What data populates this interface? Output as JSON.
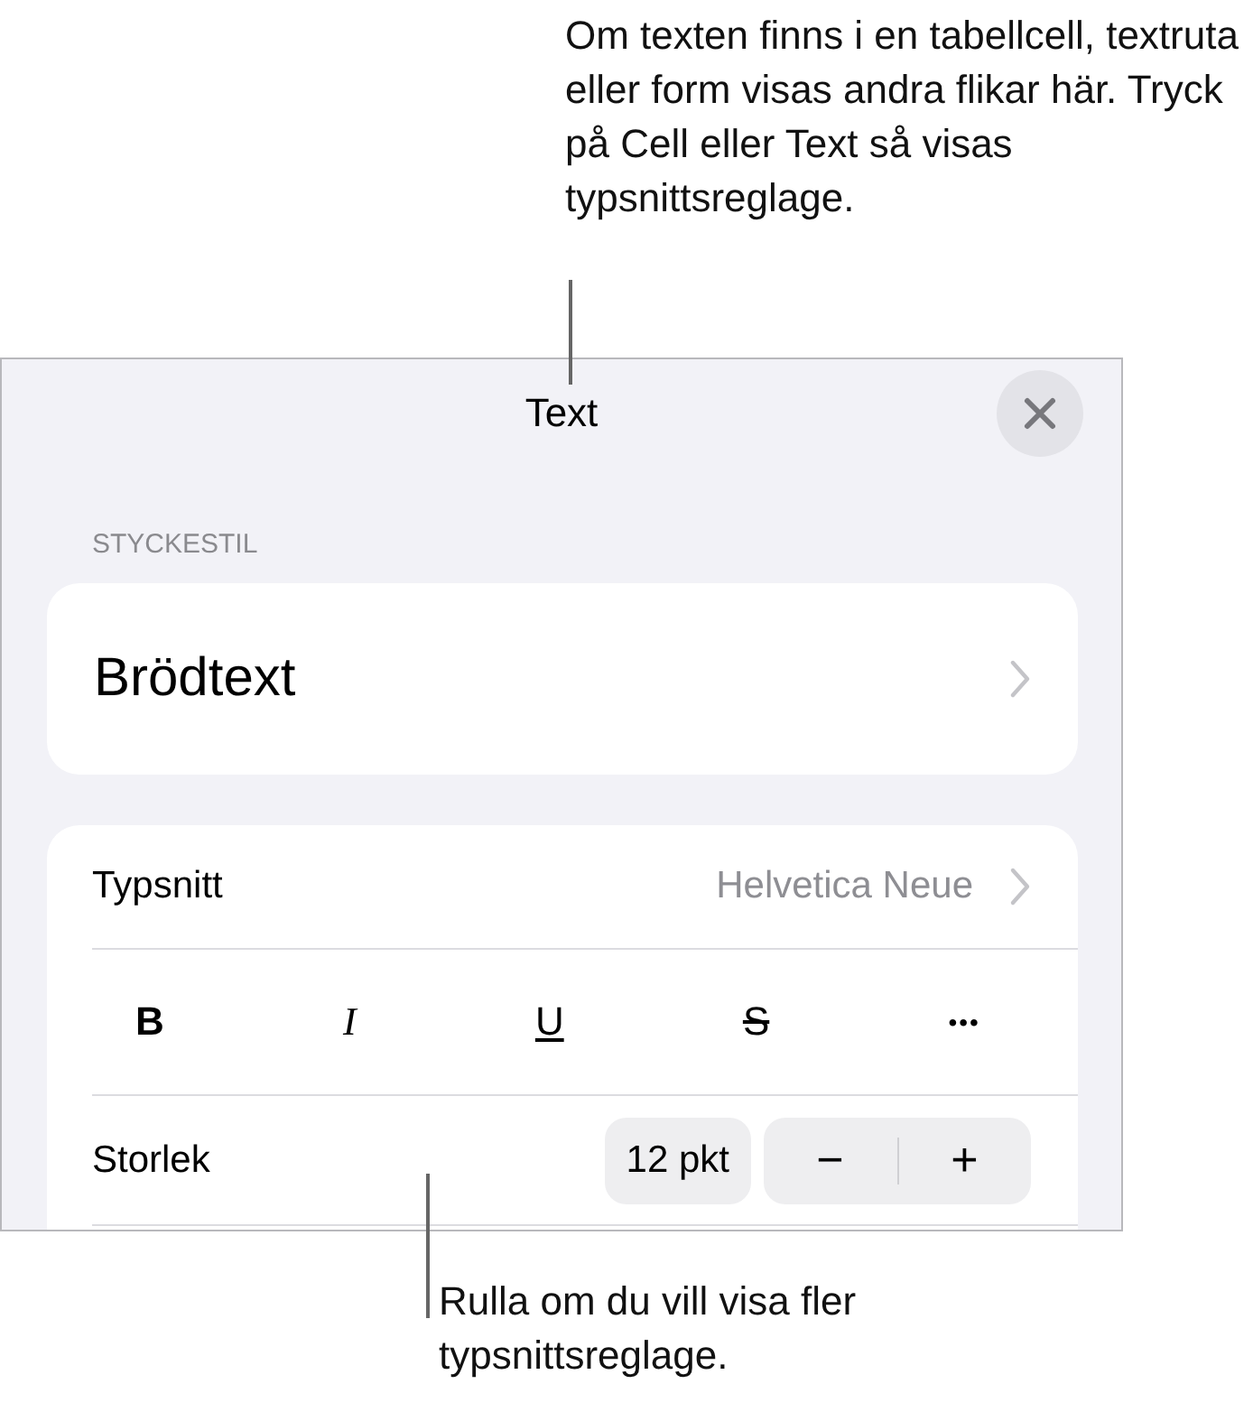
{
  "callout_top": {
    "text": "Om texten finns i en tabellcell, textruta eller form visas andra flikar här. Tryck på Cell eller Text så visas typsnittsreglage."
  },
  "panel": {
    "title": "Text",
    "section_label": "STYCKESTIL",
    "paragraph_style": "Brödtext",
    "font": {
      "label": "Typsnitt",
      "value": "Helvetica Neue"
    },
    "style_buttons": [
      {
        "kind": "bold",
        "label": "B"
      },
      {
        "kind": "italic",
        "label": "I"
      },
      {
        "kind": "underline",
        "label": "U"
      },
      {
        "kind": "strike",
        "label": "S"
      },
      {
        "kind": "more",
        "label": "•••"
      }
    ],
    "size": {
      "label": "Storlek",
      "value": "12 pkt",
      "decrease": "−",
      "increase": "+"
    }
  },
  "callout_bottom": {
    "text": "Rulla om du vill visa fler typsnittsreglage."
  }
}
